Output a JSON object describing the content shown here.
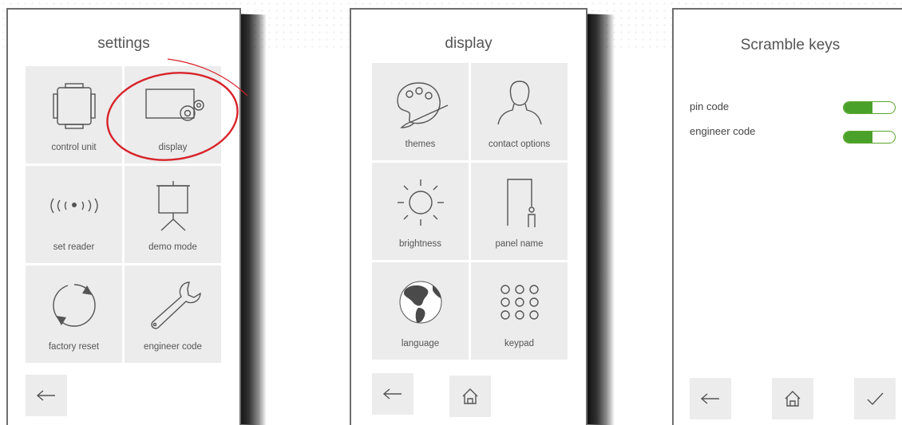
{
  "panels": {
    "settings": {
      "title": "settings",
      "tiles": [
        "control unit",
        "display",
        "set reader",
        "demo mode",
        "factory reset",
        "engineer code"
      ]
    },
    "display": {
      "title": "display",
      "tiles": [
        "themes",
        "contact options",
        "brightness",
        "panel name",
        "language",
        "keypad"
      ]
    },
    "scramble": {
      "title": "Scramble keys",
      "rows": [
        {
          "label": "pin code",
          "on": true
        },
        {
          "label": "engineer code",
          "on": true
        }
      ]
    }
  },
  "icons": {
    "back": "back-arrow-icon",
    "home": "home-icon",
    "confirm": "checkmark-icon"
  },
  "colors": {
    "accent_toggle": "#4aa12a",
    "highlight_circle": "#d8232a",
    "tile_bg": "#ececec"
  }
}
